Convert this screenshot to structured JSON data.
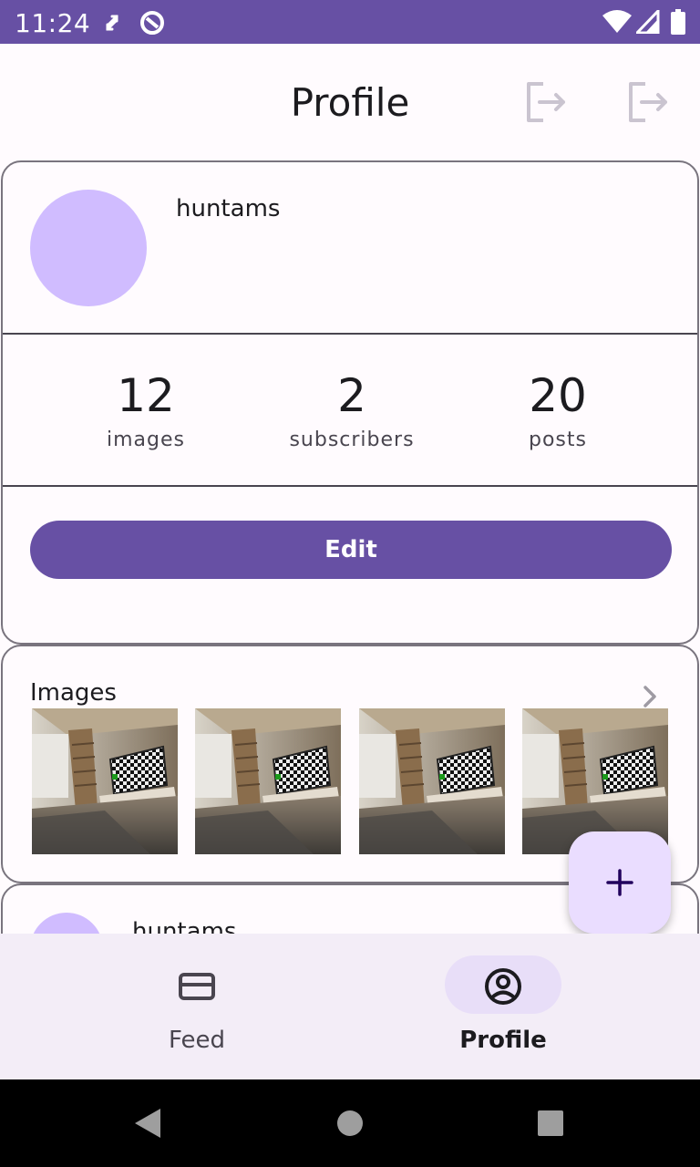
{
  "status_bar": {
    "time": "11:24",
    "icons": [
      "sync-icon",
      "do-not-disturb-icon",
      "wifi-icon",
      "signal-icon",
      "battery-icon"
    ]
  },
  "header": {
    "title": "Profile",
    "actions": [
      "logout-icon",
      "logout-icon"
    ]
  },
  "profile": {
    "username": "huntams",
    "stats": [
      {
        "value": "12",
        "label": "images"
      },
      {
        "value": "2",
        "label": "subscribers"
      },
      {
        "value": "20",
        "label": "posts"
      }
    ],
    "edit_label": "Edit"
  },
  "images_section": {
    "title": "Images",
    "thumbnail_count": 4
  },
  "post_preview": {
    "username": "huntams"
  },
  "fab": {
    "icon": "add-icon"
  },
  "bottom_nav": {
    "items": [
      {
        "label": "Feed",
        "icon": "feed-card-icon",
        "active": false
      },
      {
        "label": "Profile",
        "icon": "account-circle-icon",
        "active": true
      }
    ]
  },
  "system_nav": [
    "back-icon",
    "home-icon",
    "recents-icon"
  ],
  "colors": {
    "primary": "#6750A4",
    "avatar": "#D0BCFF",
    "fab": "#EADDFF",
    "nav_background": "#F3EDF7",
    "nav_active_pill": "#E8DEF8"
  }
}
